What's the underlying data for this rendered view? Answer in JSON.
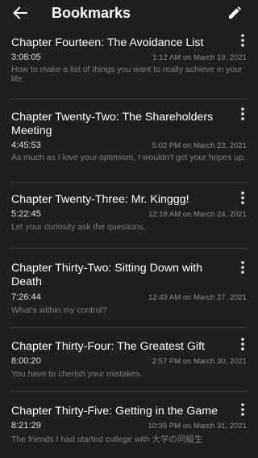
{
  "header": {
    "title": "Bookmarks",
    "back_icon": "arrow-left-icon",
    "edit_icon": "pencil-icon"
  },
  "colors": {
    "background": "#1f1f1f",
    "title_text": "#ffffff",
    "meta_text": "#8a8a8a",
    "note_text": "#7e7e7e",
    "divider": "#3a3a3a"
  },
  "bookmarks": [
    {
      "chapter": "Chapter Fourteen: The Avoidance List",
      "duration": "3:08:05",
      "timestamp": "1:12 AM on March 19, 2021",
      "note": "How to make a list of things you want to really achieve in your life."
    },
    {
      "chapter": "Chapter Twenty-Two: The Shareholders Meeting",
      "duration": "4:45:53",
      "timestamp": "5:02 PM on March 23, 2021",
      "note": "As much as I love your optimism, I wouldn't get your hopes up."
    },
    {
      "chapter": "Chapter Twenty-Three: Mr. Kinggg!",
      "duration": "5:22:45",
      "timestamp": "12:18 AM on March 24, 2021",
      "note": "Let your curiosity ask the questions."
    },
    {
      "chapter": "Chapter Thirty-Two: Sitting Down with Death",
      "duration": "7:26:44",
      "timestamp": "12:49 AM on March 27, 2021",
      "note": "What's within my control?"
    },
    {
      "chapter": "Chapter Thirty-Four: The Greatest Gift",
      "duration": "8:00:20",
      "timestamp": "2:57 PM on March 30, 2021",
      "note": "You have to cherish your mistakes."
    },
    {
      "chapter": "Chapter Thirty-Five: Getting in the Game",
      "duration": "8:21:29",
      "timestamp": "10:35 PM on March 31, 2021",
      "note": "The friends I had started college with 大学の同級生"
    }
  ]
}
